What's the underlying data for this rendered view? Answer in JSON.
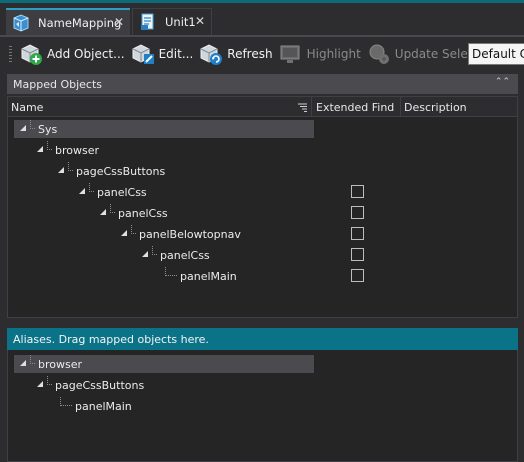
{
  "tabs": [
    {
      "label": "NameMapping",
      "active": true,
      "icon": "namemapping-icon",
      "close": "✕"
    },
    {
      "label": "Unit1",
      "active": false,
      "icon": "script-unit-icon",
      "close": "✕"
    }
  ],
  "toolbar": {
    "buttons": [
      {
        "label": "Add Object...",
        "icon": "add-object-icon",
        "enabled": true
      },
      {
        "label": "Edit...",
        "icon": "edit-icon",
        "enabled": true
      },
      {
        "label": "Refresh",
        "icon": "refresh-icon",
        "enabled": true
      },
      {
        "label": "Highlight",
        "icon": "highlight-icon",
        "enabled": false
      },
      {
        "label": "Update Selectors",
        "icon": "update-selectors-icon",
        "enabled": false
      }
    ],
    "combo_value": "Default Co"
  },
  "mapped": {
    "header": "Mapped Objects",
    "columns": {
      "name": "Name",
      "extended_find": "Extended Find",
      "description": "Description"
    },
    "rows": [
      {
        "label": "Sys",
        "level": 0,
        "expanded": true,
        "checkbox": false,
        "selected": true
      },
      {
        "label": "browser",
        "level": 1,
        "expanded": true,
        "checkbox": false,
        "selected": false
      },
      {
        "label": "pageCssButtons",
        "level": 2,
        "expanded": true,
        "checkbox": false,
        "selected": false
      },
      {
        "label": "panelCss",
        "level": 3,
        "expanded": true,
        "checkbox": true,
        "selected": false
      },
      {
        "label": "panelCss",
        "level": 4,
        "expanded": true,
        "checkbox": true,
        "selected": false
      },
      {
        "label": "panelBelowtopnav",
        "level": 5,
        "expanded": true,
        "checkbox": true,
        "selected": false
      },
      {
        "label": "panelCss",
        "level": 6,
        "expanded": true,
        "checkbox": true,
        "selected": false
      },
      {
        "label": "panelMain",
        "level": 7,
        "expanded": false,
        "checkbox": true,
        "selected": false
      }
    ]
  },
  "aliases": {
    "header": "Aliases. Drag mapped objects here.",
    "rows": [
      {
        "label": "browser",
        "level": 0,
        "expanded": true,
        "selected": true
      },
      {
        "label": "pageCssButtons",
        "level": 1,
        "expanded": true,
        "selected": false
      },
      {
        "label": "panelMain",
        "level": 2,
        "expanded": false,
        "selected": false
      }
    ]
  },
  "colors": {
    "accent": "#0e6b7a",
    "aliases_header": "#0b7388",
    "tab_active_border": "#2d9bc4"
  }
}
